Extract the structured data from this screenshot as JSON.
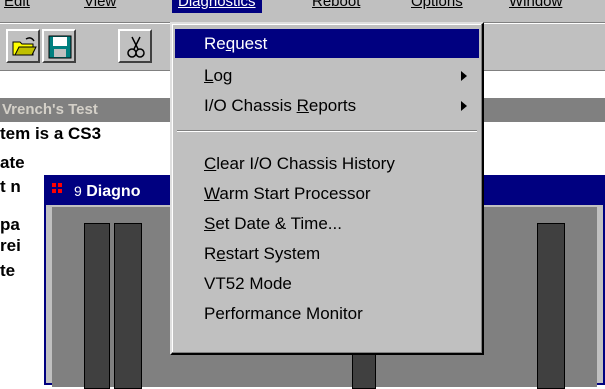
{
  "menubar": {
    "items": [
      {
        "label": "Edit",
        "key_index": 0
      },
      {
        "label": "View",
        "key_index": 0
      },
      {
        "label": "Diagnostics",
        "key_index": 0
      },
      {
        "label": "Reboot",
        "key_index": 0
      },
      {
        "label": "Options",
        "key_index": 0
      },
      {
        "label": "Window",
        "key_index": 0
      }
    ]
  },
  "toolbar": {
    "buttons": [
      "open-folder-icon",
      "save-disk-icon",
      "cut-scissors-icon"
    ]
  },
  "main_window": {
    "title": "Vrench's Test",
    "lines": [
      "tem is a CS3",
      "ate",
      "t n",
      " pa",
      "rei",
      "te"
    ]
  },
  "diag_window": {
    "title": "Diagno",
    "icon": "9"
  },
  "dropdown": {
    "items": [
      {
        "pre": "Re",
        "key": "q",
        "post": "uest",
        "submenu": false,
        "selected": true
      },
      {
        "pre": "",
        "key": "L",
        "post": "og",
        "submenu": true,
        "selected": false
      },
      {
        "pre": "I/O Chassis ",
        "key": "R",
        "post": "eports",
        "submenu": true,
        "selected": false
      },
      {
        "pre": "",
        "key": "C",
        "post": "lear I/O Chassis History",
        "submenu": false,
        "selected": false
      },
      {
        "pre": "",
        "key": "W",
        "post": "arm Start Processor",
        "submenu": false,
        "selected": false
      },
      {
        "pre": "",
        "key": "S",
        "post": "et Date & Time...",
        "submenu": false,
        "selected": false
      },
      {
        "pre": "R",
        "key": "e",
        "post": "start System",
        "submenu": false,
        "selected": false
      },
      {
        "pre": "VT52 Mode",
        "key": "",
        "post": "",
        "submenu": false,
        "selected": false
      },
      {
        "pre": "Performance Monitor",
        "key": "",
        "post": "",
        "submenu": false,
        "selected": false
      }
    ]
  },
  "colors": {
    "highlight": "#000080",
    "face": "#c0c0c0",
    "title_inactive": "#808080"
  }
}
